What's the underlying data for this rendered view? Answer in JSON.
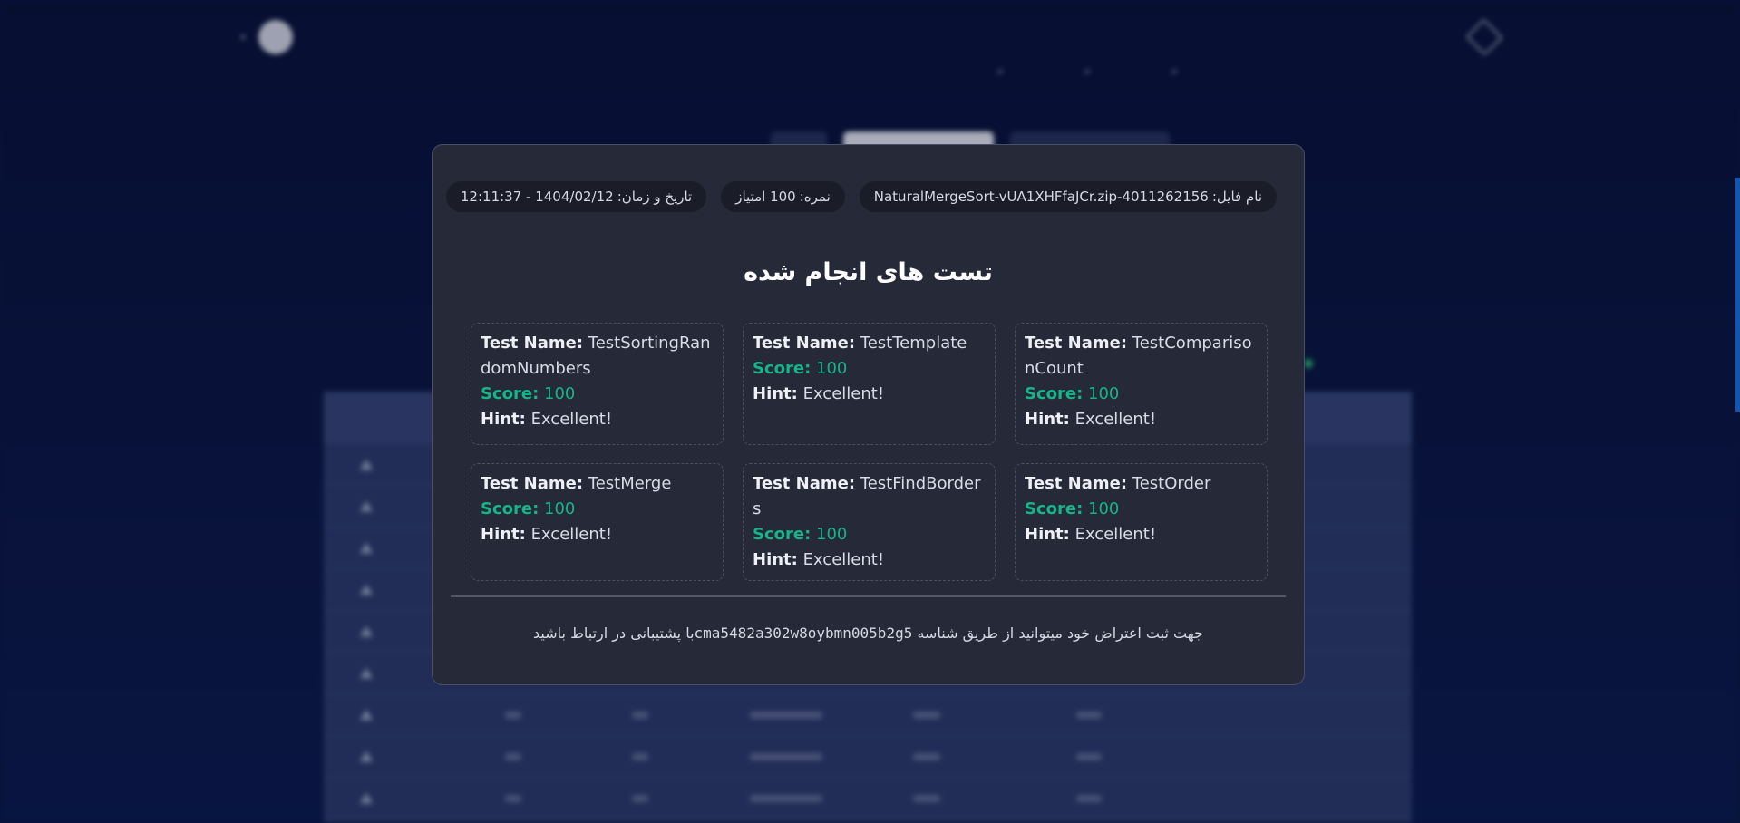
{
  "background": {
    "brand_name": "",
    "user_name": "",
    "table_rows": 9
  },
  "modal": {
    "file_chip": {
      "label": "نام فایل:",
      "value": "NaturalMergeSort-vUA1XHFfaJCr.zip-4011262156"
    },
    "score_chip": {
      "label": "نمره:",
      "value": "100 امتیاز"
    },
    "date_chip": {
      "label": "تاریخ و زمان:",
      "value": "1404/02/12 - 12:11:37"
    },
    "title": "تست های انجام شده",
    "labels": {
      "test_name": "Test Name:",
      "score": "Score:",
      "hint": "Hint:"
    },
    "tests": [
      {
        "name": "TestComparisonCount",
        "score": "100",
        "hint": "Excellent!"
      },
      {
        "name": "TestTemplate",
        "score": "100",
        "hint": "Excellent!"
      },
      {
        "name": "TestSortingRandomNumbers",
        "score": "100",
        "hint": "Excellent!"
      },
      {
        "name": "TestOrder",
        "score": "100",
        "hint": "Excellent!"
      },
      {
        "name": "TestFindBorders",
        "score": "100",
        "hint": "Excellent!"
      },
      {
        "name": "TestMerge",
        "score": "100",
        "hint": "Excellent!"
      }
    ],
    "footer": {
      "prefix": "جهت ثبت اعتراض خود میتوانید از طریق شناسه",
      "code": "cma5482a302w8oybmn005b2g5",
      "suffix": "با پشتیبانی در ارتباط باشید"
    }
  },
  "colors": {
    "page_bg": "#0a1642",
    "modal_bg": "#252938",
    "score_green": "#17b389",
    "accent_blue": "#1a73e8"
  }
}
